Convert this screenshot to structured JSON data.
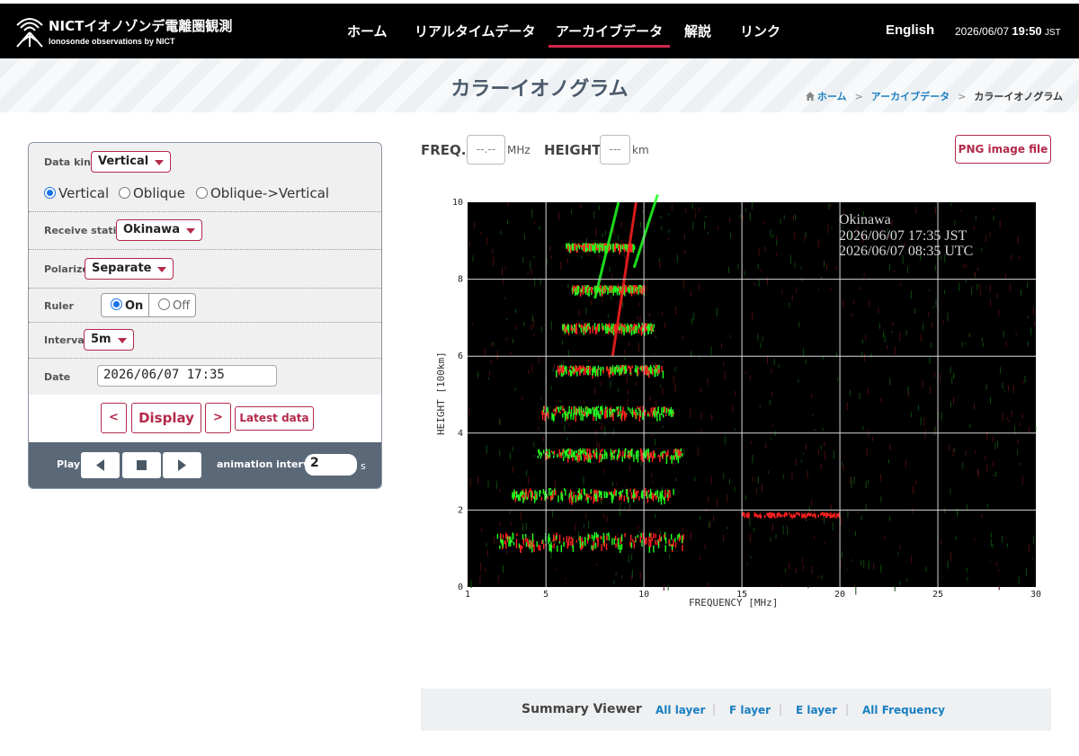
{
  "header": {
    "logo_title": "NICTイオノゾンデ電離圏観測",
    "logo_subtitle": "Ionosonde observations by NICT",
    "nav": [
      "ホーム",
      "リアルタイムデータ",
      "アーカイブデータ",
      "解説",
      "リンク"
    ],
    "active_nav": "アーカイブデータ",
    "language": "English",
    "clock_date": "2026/06/07",
    "clock_time": "19:50",
    "clock_zone": "JST"
  },
  "page": {
    "title": "カラーイオノグラム",
    "breadcrumb": [
      "ホーム",
      "アーカイブデータ",
      "カラーイオノグラム"
    ],
    "breadcrumb_sep": ">"
  },
  "controls": {
    "data_kind": {
      "label": "Data kind",
      "value": "Vertical"
    },
    "mode_options": [
      "Vertical",
      "Oblique",
      "Oblique->Vertical"
    ],
    "mode_selected": "Vertical",
    "receive_station": {
      "label": "Receive station",
      "value": "Okinawa"
    },
    "polarize": {
      "label": "Polarize",
      "value": "Separate"
    },
    "ruler": {
      "label": "Ruler",
      "on": "On",
      "off": "Off",
      "selected": "On"
    },
    "interval": {
      "label": "Interval",
      "value": "5m"
    },
    "date": {
      "label": "Date",
      "value": "2026/06/07 17:35"
    },
    "prev_label": "<",
    "display_label": "Display",
    "next_label": ">",
    "latest_label": "Latest data",
    "play_label": "Play",
    "animation_label": "animation interval",
    "animation_value": "2",
    "animation_unit": "s"
  },
  "readout": {
    "freq_label": "FREQ.:",
    "freq_placeholder": "--.--",
    "freq_unit": "MHz",
    "height_label": "HEIGHT:",
    "height_placeholder": "---",
    "height_unit": "km",
    "png_label": "PNG image file"
  },
  "ionogram": {
    "station": "Okinawa",
    "time_jst": "2026/06/07 17:35 JST",
    "time_utc": "2026/06/07 08:35 UTC",
    "x_label": "FREQUENCY [MHz]",
    "y_label": "HEIGHT [100km]",
    "x_ticks": [
      1,
      5,
      10,
      15,
      20,
      25,
      30
    ],
    "y_ticks": [
      0,
      2,
      4,
      6,
      8,
      10
    ],
    "x_range": [
      1,
      30
    ],
    "y_range": [
      0,
      10
    ],
    "trace_colors": {
      "ordinary": "#ff2020",
      "extraordinary": "#20ff20"
    }
  },
  "summary": {
    "title": "Summary Viewer",
    "links": [
      "All layer",
      "F layer",
      "E layer",
      "All Frequency"
    ],
    "separator": "|"
  }
}
